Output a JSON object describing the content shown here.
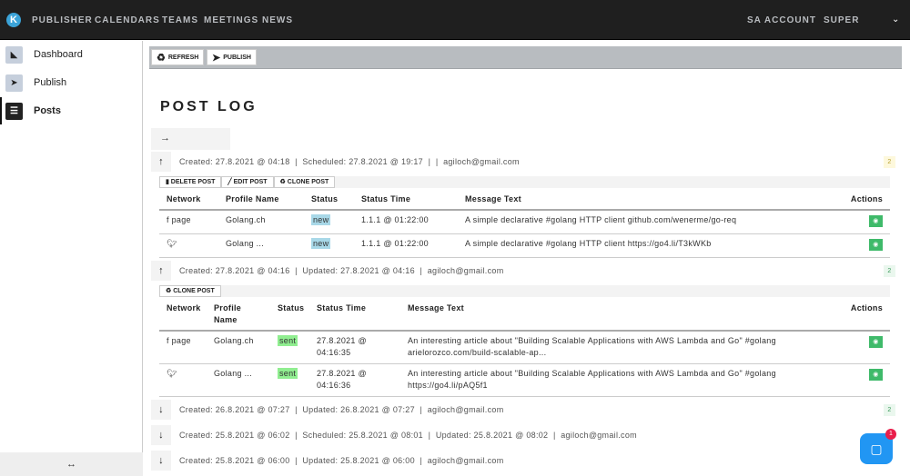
{
  "nav": {
    "logo": "K",
    "items": [
      "PUBLISHER",
      "CALENDARS",
      "TEAMS",
      "MEETINGS",
      "NEWS"
    ],
    "account": "SA ACCOUNT",
    "user": "SUPER"
  },
  "sidebar": {
    "items": [
      {
        "label": "Dashboard"
      },
      {
        "label": "Publish"
      },
      {
        "label": "Posts"
      }
    ],
    "footer": "↔"
  },
  "toolbar": {
    "refresh": "REFRESH",
    "publish": "PUBLISH"
  },
  "page_title": "POST LOG",
  "expand": "→",
  "posts": [
    {
      "meta": "Created: 27.8.2021 @ 04:18  |  Scheduled: 27.8.2021 @ 19:17  |  |  agiloch@gmail.com",
      "count": "2",
      "actions": [
        "DELETE POST",
        "EDIT POST",
        "CLONE POST"
      ],
      "headers": [
        "Network",
        "Profile Name",
        "Status",
        "Status Time",
        "Message Text",
        "Actions"
      ],
      "rows": [
        {
          "network": "page",
          "profile": "Golang.ch",
          "status": "new",
          "time": "1.1.1 @ 01:22:00",
          "message": "A simple declarative #golang HTTP client github.com/wenerme/go-req"
        },
        {
          "network": "",
          "profile": "Golang ...",
          "status": "new",
          "time": "1.1.1 @ 01:22:00",
          "message": "A simple declarative #golang HTTP client https://go4.li/T3kWKb"
        }
      ]
    },
    {
      "meta": "Created: 27.8.2021 @ 04:16  |  Updated: 27.8.2021 @ 04:16  |  agiloch@gmail.com",
      "count": "2",
      "actions": [
        "CLONE POST"
      ],
      "headers": [
        "Network",
        "Profile Name",
        "Status",
        "Status Time",
        "Message Text",
        "Actions"
      ],
      "rows": [
        {
          "network": "page",
          "profile": "Golang.ch",
          "status": "sent",
          "time": "27.8.2021 @ 04:16:35",
          "message": "An interesting article about \"Building Scalable Applications with AWS Lambda and Go\" #golang arielorozco.com/build-scalable-ap..."
        },
        {
          "network": "",
          "profile": "Golang ...",
          "status": "sent",
          "time": "27.8.2021 @ 04:16:36",
          "message": "An interesting article about \"Building Scalable Applications with AWS Lambda and Go\" #golang https://go4.li/pAQ5f1"
        }
      ]
    },
    {
      "meta": "Created: 26.8.2021 @ 07:27  |  Updated: 26.8.2021 @ 07:27  |  agiloch@gmail.com",
      "count": "2"
    },
    {
      "meta": "Created: 25.8.2021 @ 06:02  |  Scheduled: 25.8.2021 @ 08:01  |  Updated: 25.8.2021 @ 08:02  |  agiloch@gmail.com"
    },
    {
      "meta": "Created: 25.8.2021 @ 06:00  |  Updated: 25.8.2021 @ 06:00  |  agiloch@gmail.com"
    }
  ],
  "chat": {
    "badge": "1"
  },
  "colors": {
    "nav": "#1f1f1f",
    "new": "#a8d8e8",
    "sent": "#90ee90",
    "action": "#3fba6a",
    "chat": "#2196f3"
  }
}
